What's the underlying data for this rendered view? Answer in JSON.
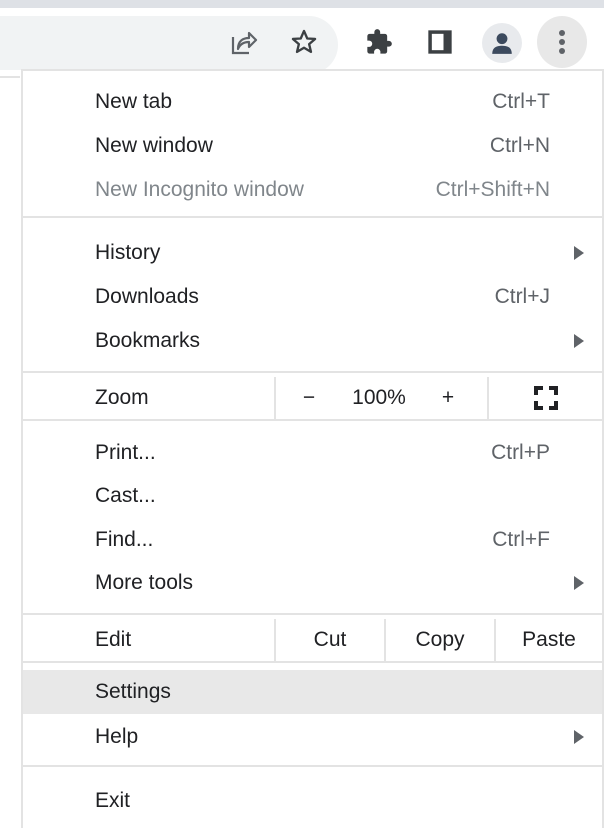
{
  "toolbar": {
    "icons": [
      "share-icon",
      "bookmark-star-icon",
      "extensions-puzzle-icon",
      "side-panel-icon",
      "profile-avatar-icon",
      "more-vertical-icon"
    ]
  },
  "menu": {
    "items": [
      {
        "label": "New tab",
        "shortcut": "Ctrl+T"
      },
      {
        "label": "New window",
        "shortcut": "Ctrl+N"
      },
      {
        "label": "New Incognito window",
        "shortcut": "Ctrl+Shift+N"
      },
      {
        "label": "History",
        "shortcut": ""
      },
      {
        "label": "Downloads",
        "shortcut": "Ctrl+J"
      },
      {
        "label": "Bookmarks",
        "shortcut": ""
      },
      {
        "label": "Print...",
        "shortcut": "Ctrl+P"
      },
      {
        "label": "Cast...",
        "shortcut": ""
      },
      {
        "label": "Find...",
        "shortcut": "Ctrl+F"
      },
      {
        "label": "More tools",
        "shortcut": ""
      },
      {
        "label": "Settings",
        "shortcut": ""
      },
      {
        "label": "Help",
        "shortcut": ""
      },
      {
        "label": "Exit",
        "shortcut": ""
      }
    ],
    "zoom": {
      "label": "Zoom",
      "minus": "−",
      "value": "100%",
      "plus": "+"
    },
    "edit": {
      "label": "Edit",
      "cut": "Cut",
      "copy": "Copy",
      "paste": "Paste"
    }
  }
}
